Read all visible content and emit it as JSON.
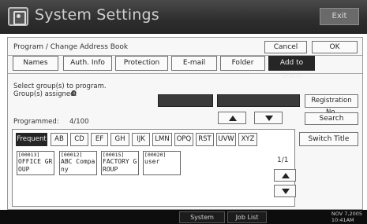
{
  "header": {
    "title": "System Settings",
    "exit_label": "Exit"
  },
  "dialog": {
    "title": "Program / Change Address Book",
    "cancel_label": "Cancel",
    "ok_label": "OK"
  },
  "tabs": [
    {
      "label": "Names"
    },
    {
      "label": "Auth. Info"
    },
    {
      "label": "Protection"
    },
    {
      "label": "E-mail"
    },
    {
      "label": "Folder"
    },
    {
      "label": "Add to Group",
      "selected": true
    }
  ],
  "program": {
    "instruction": "Select group(s) to program.",
    "assigned_label": "Group(s) assigned:",
    "assigned_value": "0",
    "programmed_label": "Programmed:",
    "programmed_value": "4/100",
    "registration_label": "Registration No.",
    "search_label": "Search"
  },
  "group_tabs": [
    {
      "label": "Frequent",
      "selected": true
    },
    {
      "label": "AB"
    },
    {
      "label": "CD"
    },
    {
      "label": "EF"
    },
    {
      "label": "GH"
    },
    {
      "label": "IJK"
    },
    {
      "label": "LMN"
    },
    {
      "label": "OPQ"
    },
    {
      "label": "RST"
    },
    {
      "label": "UVW"
    },
    {
      "label": "XYZ"
    }
  ],
  "switch_title_label": "Switch Title",
  "entries": [
    {
      "code": "[00013]",
      "name": "OFFICE GROUP"
    },
    {
      "code": "[00012]",
      "name": "ABC Company"
    },
    {
      "code": "[00015]",
      "name": "FACTORY GROUP"
    },
    {
      "code": "[00020]",
      "name": "user"
    }
  ],
  "pagination": {
    "page": "1/1"
  },
  "statusbar": {
    "system_status_label": "System Status",
    "job_list_label": "Job List",
    "date": "NOV   7,2005",
    "time": "10:41AM"
  },
  "colors": {
    "selected": "#262626",
    "title_bar": "#3a3a3a",
    "status_bar": "#0d0d0d"
  }
}
